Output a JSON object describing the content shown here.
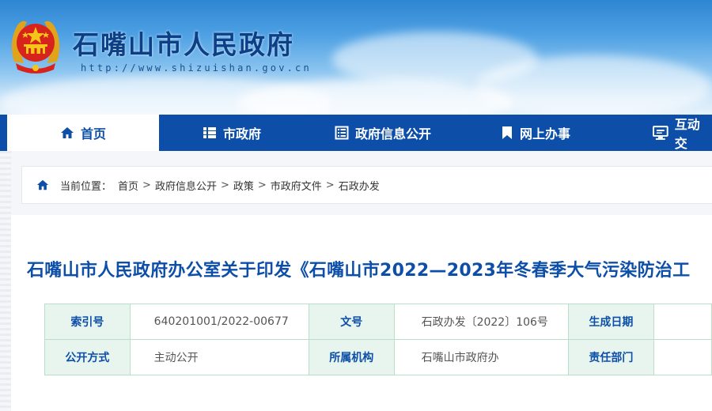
{
  "header": {
    "site_title": "石嘴山市人民政府",
    "site_url": "http://www.shizuishan.gov.cn",
    "emblem_icon": "national-emblem-icon"
  },
  "nav": {
    "items": [
      {
        "label": "首页",
        "icon": "home-icon",
        "active": true
      },
      {
        "label": "市政府",
        "icon": "list-icon",
        "active": false
      },
      {
        "label": "政府信息公开",
        "icon": "document-list-icon",
        "active": false
      },
      {
        "label": "网上办事",
        "icon": "bookmark-icon",
        "active": false
      },
      {
        "label": "互动交",
        "icon": "monitor-chat-icon",
        "active": false
      }
    ]
  },
  "breadcrumb": {
    "prefix": "当前位置：",
    "items": [
      "首页",
      "政府信息公开",
      "政策",
      "市政府文件",
      "石政办发"
    ],
    "separator": ">"
  },
  "article": {
    "title": "石嘴山市人民政府办公室关于印发《石嘴山市2022—2023年冬春季大气污染防治工"
  },
  "meta": {
    "rows": [
      {
        "l1": "索引号",
        "v1": "640201001/2022-00677",
        "l2": "文号",
        "v2": "石政办发〔2022〕106号",
        "l3": "生成日期"
      },
      {
        "l1": "公开方式",
        "v1": "主动公开",
        "l2": "所属机构",
        "v2": "石嘴山市政府办",
        "l3": "责任部门"
      }
    ]
  },
  "colors": {
    "nav_bg": "#0d4fa8",
    "title_blue": "#0d4fa8",
    "label_bg": "#e8f5ee",
    "table_border": "#b9dfca"
  }
}
